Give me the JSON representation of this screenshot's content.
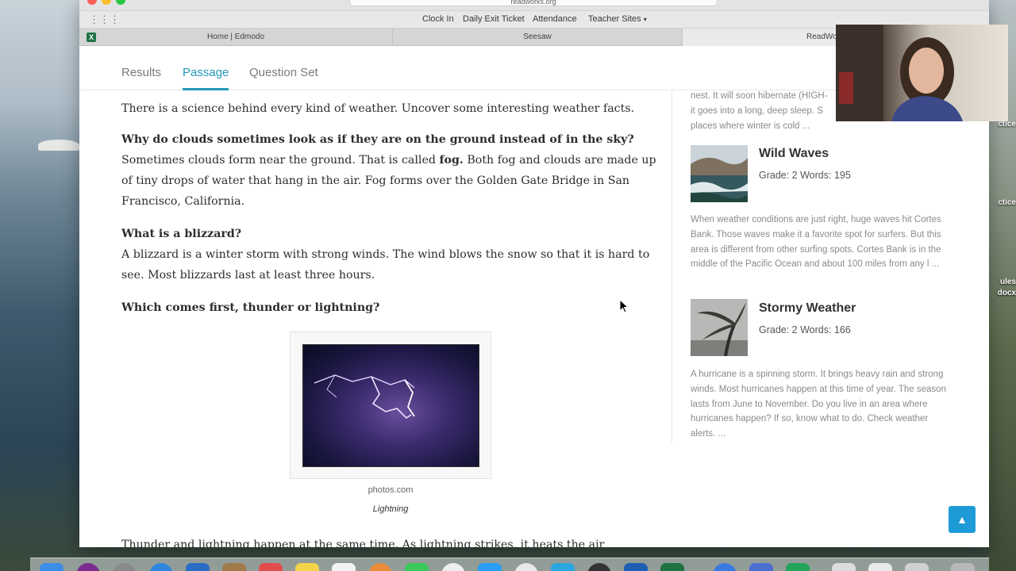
{
  "browser": {
    "url": "readworks.org",
    "bookmarks": [
      "Clock In",
      "Daily Exit Ticket",
      "Attendance",
      "Teacher Sites"
    ],
    "tabs": [
      "Home | Edmodo",
      "Seesaw",
      "ReadWorks"
    ]
  },
  "page_tabs": [
    "Results",
    "Passage",
    "Question Set"
  ],
  "passage": {
    "intro": "There is a science behind every kind of weather. Uncover some interesting weather facts.",
    "q1": "Why do clouds sometimes look as if they are on the ground instead of in the sky?",
    "a1_before": "Sometimes clouds form near the ground. That is called ",
    "a1_bold": "fog.",
    "a1_after": " Both fog and clouds are made up of tiny drops of water that hang in the air. Fog forms over the Golden Gate Bridge in San Francisco, California.",
    "q2": "What is a blizzard?",
    "a2": "A blizzard is a winter storm with strong winds. The wind blows the snow so that it is hard to see. Most blizzards last at least three hours.",
    "q3": "Which comes first, thunder or lightning?",
    "photo_credit": "photos.com",
    "photo_caption": "Lightning",
    "tail": "Thunder and lightning happen at the same time. As lightning strikes, it heats the air"
  },
  "sidebar": {
    "top_snippet": [
      "nest. It will soon hibernate (HIGH-",
      "it goes into a long, deep sleep. S",
      "places where winter is cold ..."
    ],
    "items": [
      {
        "title": "Wild Waves",
        "meta": "Grade: 2 Words: 195",
        "snippet": "When weather conditions are just right, huge waves hit Cortes Bank. Those waves make it a favorite spot for surfers. But this area is different from other surfing spots. Cortes Bank is in the middle of the Pacific Ocean and about 100 miles from any l ..."
      },
      {
        "title": "Stormy Weather",
        "meta": "Grade: 2 Words: 166",
        "snippet": "A hurricane is a spinning storm. It brings heavy rain and strong winds. Most hurricanes happen at this time of year. The season lasts from June to November. Do you live in an area where hurricanes happen? If so, know what to do. Check weather alerts. ..."
      }
    ]
  },
  "desktop_labels": [
    "ctice",
    "ctice",
    "ules",
    "docx"
  ],
  "colors": {
    "accent": "#2597b7",
    "top_button": "#1e9bd7"
  }
}
